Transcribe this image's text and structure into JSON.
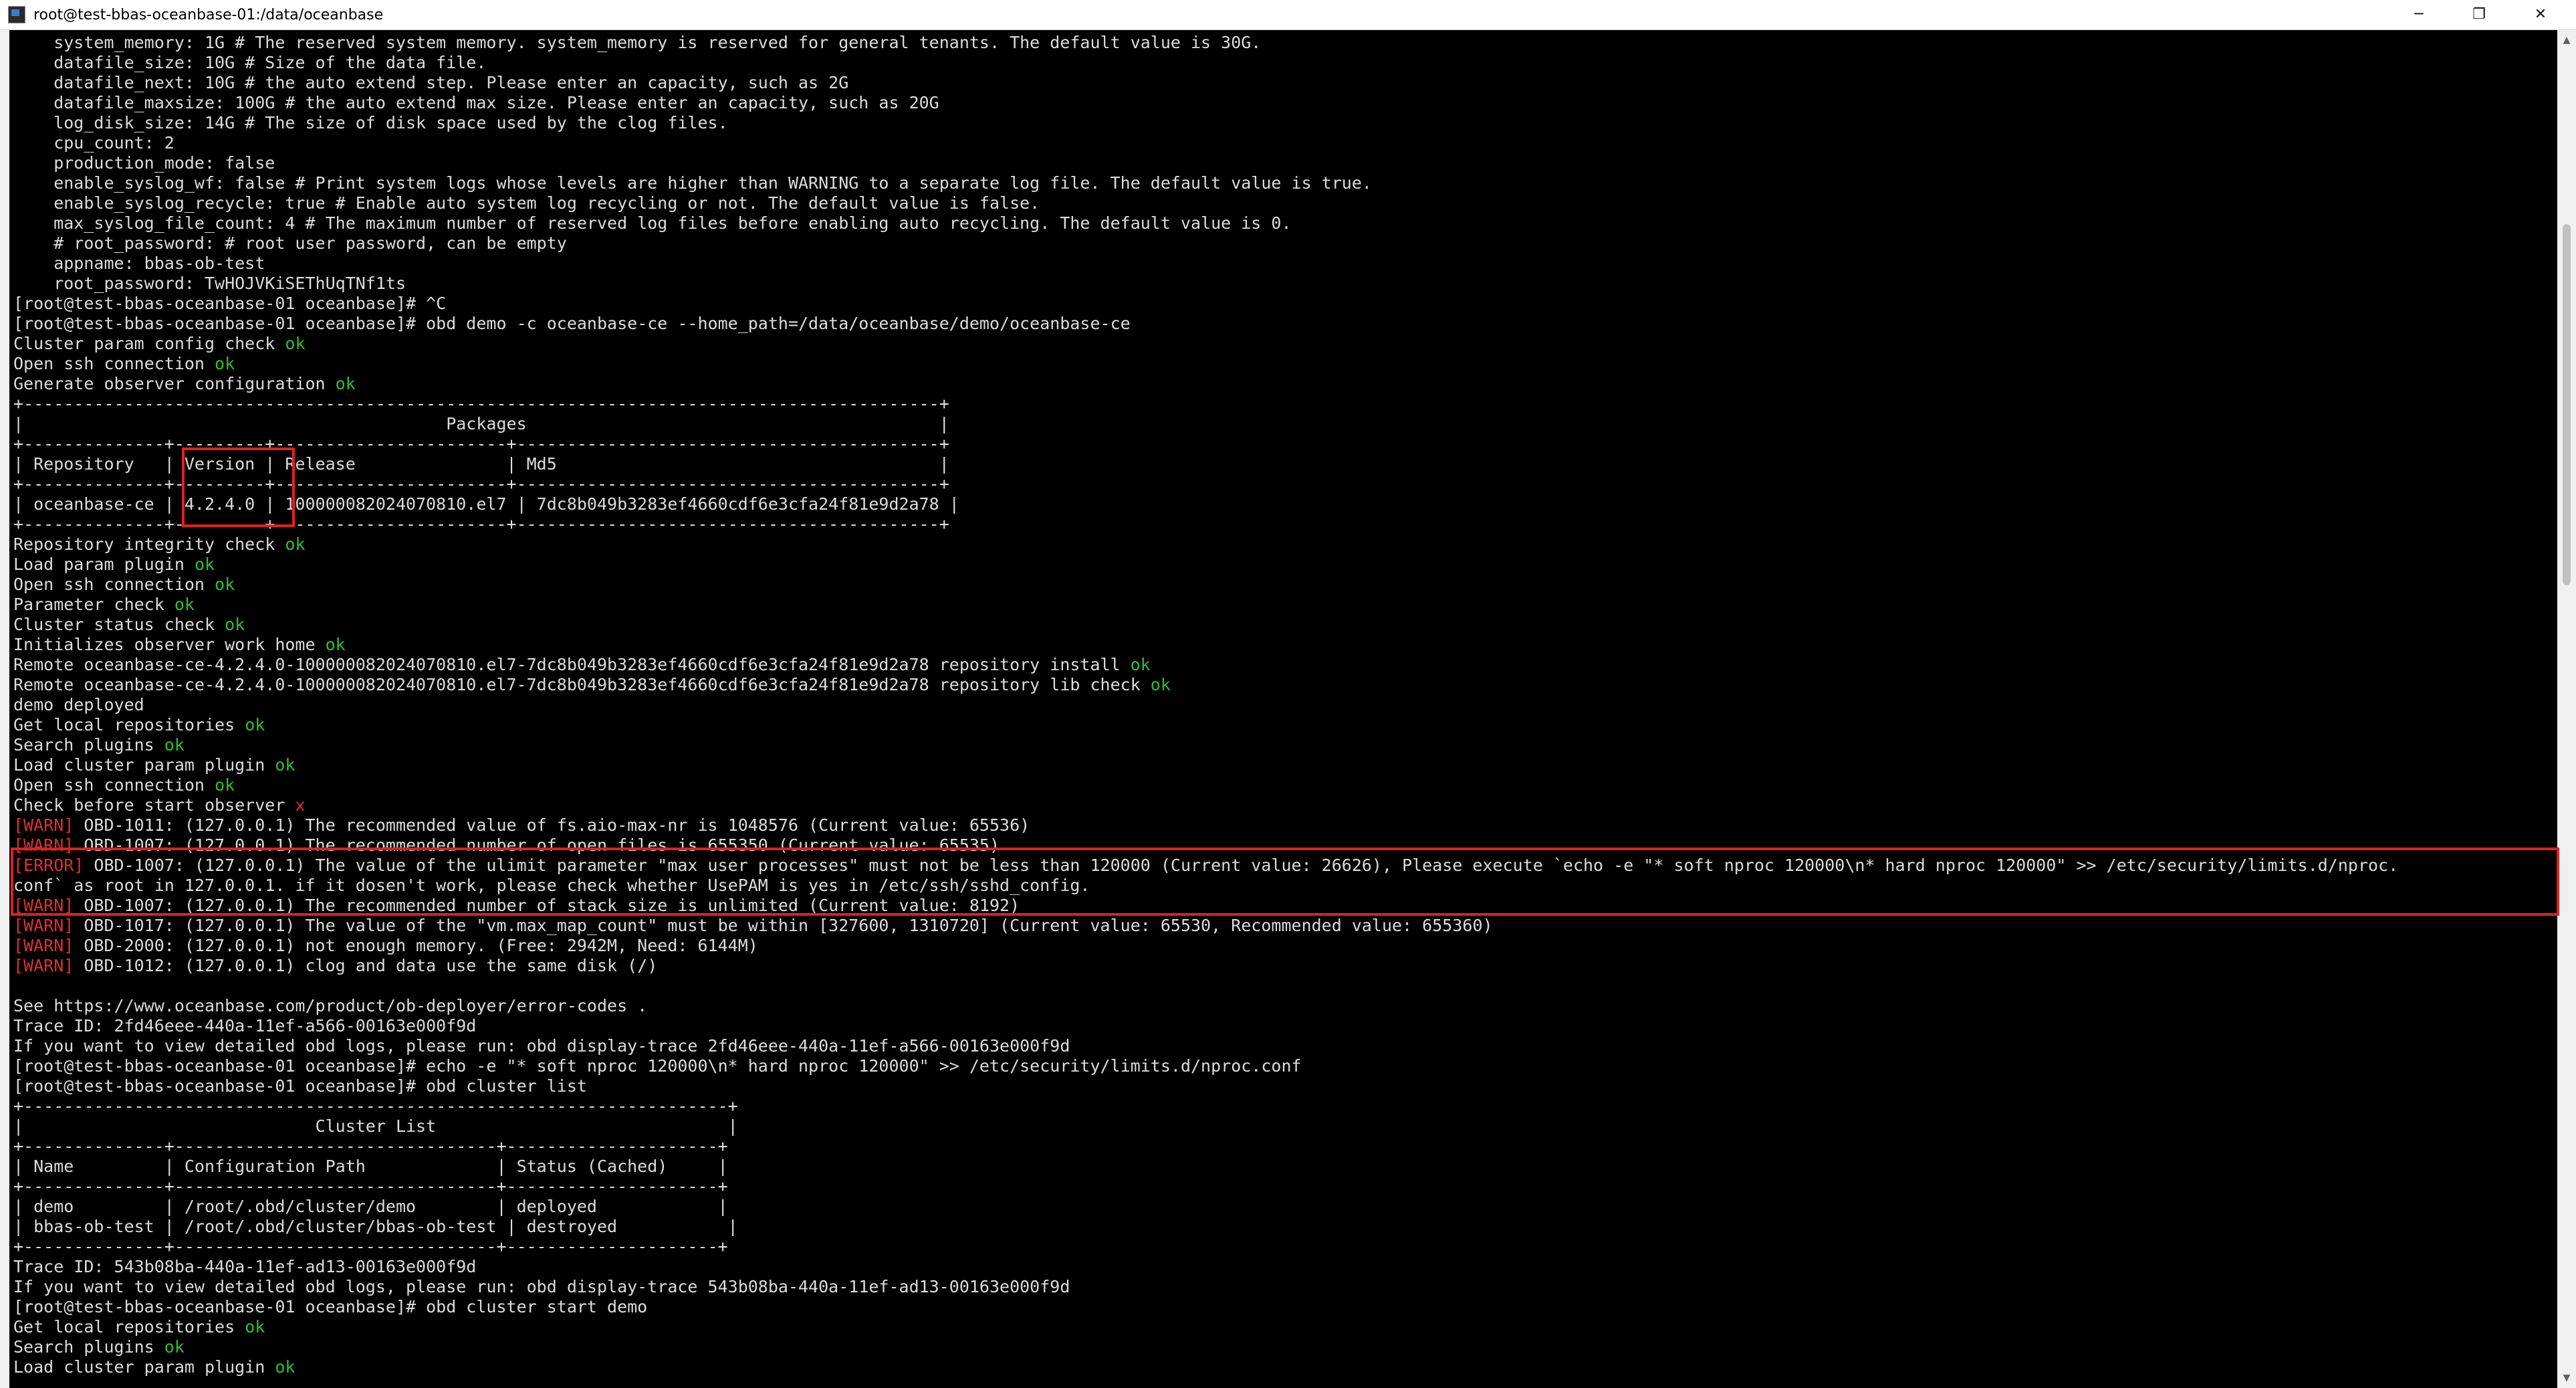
{
  "window": {
    "title": "root@test-bbas-oceanbase-01:/data/oceanbase",
    "minimize_icon": "─",
    "maximize_icon": "❐",
    "close_icon": "✕"
  },
  "scrollbar": {
    "up_arrow": "▲",
    "down_arrow": "▼"
  },
  "colors": {
    "ok": "#2fbf2f",
    "error": "#e03030",
    "highlight_box": "#e02020",
    "text": "#dcdcdc",
    "background": "#000000"
  },
  "terminal": {
    "lines": [
      [
        {
          "t": "    system_memory: 1G # The reserved system memory. system_memory is reserved for general tenants. The default value is 30G."
        }
      ],
      [
        {
          "t": "    datafile_size: 10G # Size of the data file."
        }
      ],
      [
        {
          "t": "    datafile_next: 10G # the auto extend step. Please enter an capacity, such as 2G"
        }
      ],
      [
        {
          "t": "    datafile_maxsize: 100G # the auto extend max size. Please enter an capacity, such as 20G"
        }
      ],
      [
        {
          "t": "    log_disk_size: 14G # The size of disk space used by the clog files."
        }
      ],
      [
        {
          "t": "    cpu_count: 2"
        }
      ],
      [
        {
          "t": "    production_mode: false"
        }
      ],
      [
        {
          "t": "    enable_syslog_wf: false # Print system logs whose levels are higher than WARNING to a separate log file. The default value is true."
        }
      ],
      [
        {
          "t": "    enable_syslog_recycle: true # Enable auto system log recycling or not. The default value is false."
        }
      ],
      [
        {
          "t": "    max_syslog_file_count: 4 # The maximum number of reserved log files before enabling auto recycling. The default value is 0."
        }
      ],
      [
        {
          "t": "    # root_password: # root user password, can be empty"
        }
      ],
      [
        {
          "t": "    appname: bbas-ob-test"
        }
      ],
      [
        {
          "t": "    root_password: TwHOJVKiSEThUqTNf1ts"
        }
      ],
      [
        {
          "t": "[root@test-bbas-oceanbase-01 oceanbase]# ^C"
        }
      ],
      [
        {
          "t": "[root@test-bbas-oceanbase-01 oceanbase]# obd demo -c oceanbase-ce --home_path=/data/oceanbase/demo/oceanbase-ce"
        }
      ],
      [
        {
          "t": "Cluster param config check "
        },
        {
          "t": "ok",
          "c": "ok"
        }
      ],
      [
        {
          "t": "Open ssh connection "
        },
        {
          "t": "ok",
          "c": "ok"
        }
      ],
      [
        {
          "t": "Generate observer configuration "
        },
        {
          "t": "ok",
          "c": "ok"
        }
      ],
      [
        {
          "t": "+-------------------------------------------------------------------------------------------+"
        }
      ],
      [
        {
          "t": "|                                          Packages                                         |"
        }
      ],
      [
        {
          "t": "+--------------+---------+-----------------------+------------------------------------------+"
        }
      ],
      [
        {
          "t": "| Repository   | Version | Release               | Md5                                      |"
        }
      ],
      [
        {
          "t": "+--------------+---------+-----------------------+------------------------------------------+"
        }
      ],
      [
        {
          "t": "| oceanbase-ce | 4.2.4.0 | 100000082024070810.el7 | 7dc8b049b3283ef4660cdf6e3cfa24f81e9d2a78 |"
        }
      ],
      [
        {
          "t": "+--------------+---------+-----------------------+------------------------------------------+"
        }
      ],
      [
        {
          "t": "Repository integrity check "
        },
        {
          "t": "ok",
          "c": "ok"
        }
      ],
      [
        {
          "t": "Load param plugin "
        },
        {
          "t": "ok",
          "c": "ok"
        }
      ],
      [
        {
          "t": "Open ssh connection "
        },
        {
          "t": "ok",
          "c": "ok"
        }
      ],
      [
        {
          "t": "Parameter check "
        },
        {
          "t": "ok",
          "c": "ok"
        }
      ],
      [
        {
          "t": "Cluster status check "
        },
        {
          "t": "ok",
          "c": "ok"
        }
      ],
      [
        {
          "t": "Initializes observer work home "
        },
        {
          "t": "ok",
          "c": "ok"
        }
      ],
      [
        {
          "t": "Remote oceanbase-ce-4.2.4.0-100000082024070810.el7-7dc8b049b3283ef4660cdf6e3cfa24f81e9d2a78 repository install "
        },
        {
          "t": "ok",
          "c": "ok"
        }
      ],
      [
        {
          "t": "Remote oceanbase-ce-4.2.4.0-100000082024070810.el7-7dc8b049b3283ef4660cdf6e3cfa24f81e9d2a78 repository lib check "
        },
        {
          "t": "ok",
          "c": "ok"
        }
      ],
      [
        {
          "t": "demo deployed"
        }
      ],
      [
        {
          "t": "Get local repositories "
        },
        {
          "t": "ok",
          "c": "ok"
        }
      ],
      [
        {
          "t": "Search plugins "
        },
        {
          "t": "ok",
          "c": "ok"
        }
      ],
      [
        {
          "t": "Load cluster param plugin "
        },
        {
          "t": "ok",
          "c": "ok"
        }
      ],
      [
        {
          "t": "Open ssh connection "
        },
        {
          "t": "ok",
          "c": "ok"
        }
      ],
      [
        {
          "t": "Check before start observer "
        },
        {
          "t": "x",
          "c": "red"
        }
      ],
      [
        {
          "t": "[WARN]",
          "c": "red"
        },
        {
          "t": " OBD-1011: (127.0.0.1) The recommended value of fs.aio-max-nr is 1048576 (Current value: 65536)"
        }
      ],
      [
        {
          "t": "[WARN]",
          "c": "red"
        },
        {
          "t": " OBD-1007: (127.0.0.1) The recommended number of open files is 655350 (Current value: 65535)"
        }
      ],
      [
        {
          "t": "[ERROR]",
          "c": "red"
        },
        {
          "t": " OBD-1007: (127.0.0.1) The value of the ulimit parameter \"max user processes\" must not be less than 120000 (Current value: 26626), Please execute `echo -e \"* soft nproc 120000\\n* hard nproc 120000\" >> /etc/security/limits.d/nproc."
        }
      ],
      [
        {
          "t": "conf` as root in 127.0.0.1. if it dosen't work, please check whether UsePAM is yes in /etc/ssh/sshd_config."
        }
      ],
      [
        {
          "t": "[WARN]",
          "c": "red"
        },
        {
          "t": " OBD-1007: (127.0.0.1) The recommended number of stack size is unlimited (Current value: 8192)"
        }
      ],
      [
        {
          "t": "[WARN]",
          "c": "red"
        },
        {
          "t": " OBD-1017: (127.0.0.1) The value of the \"vm.max_map_count\" must be within [327600, 1310720] (Current value: 65530, Recommended value: 655360)"
        }
      ],
      [
        {
          "t": "[WARN]",
          "c": "red"
        },
        {
          "t": " OBD-2000: (127.0.0.1) not enough memory. (Free: 2942M, Need: 6144M)"
        }
      ],
      [
        {
          "t": "[WARN]",
          "c": "red"
        },
        {
          "t": " OBD-1012: (127.0.0.1) clog and data use the same disk (/)"
        }
      ],
      [
        {
          "t": ""
        }
      ],
      [
        {
          "t": "See https://www.oceanbase.com/product/ob-deployer/error-codes ."
        }
      ],
      [
        {
          "t": "Trace ID: 2fd46eee-440a-11ef-a566-00163e000f9d"
        }
      ],
      [
        {
          "t": "If you want to view detailed obd logs, please run: obd display-trace 2fd46eee-440a-11ef-a566-00163e000f9d"
        }
      ],
      [
        {
          "t": "[root@test-bbas-oceanbase-01 oceanbase]# echo -e \"* soft nproc 120000\\n* hard nproc 120000\" >> /etc/security/limits.d/nproc.conf"
        }
      ],
      [
        {
          "t": "[root@test-bbas-oceanbase-01 oceanbase]# obd cluster list"
        }
      ],
      [
        {
          "t": "+----------------------------------------------------------------------+"
        }
      ],
      [
        {
          "t": "|                             Cluster List                             |"
        }
      ],
      [
        {
          "t": "+--------------+--------------------------------+---------------------+"
        }
      ],
      [
        {
          "t": "| Name         | Configuration Path             | Status (Cached)     |"
        }
      ],
      [
        {
          "t": "+--------------+--------------------------------+---------------------+"
        }
      ],
      [
        {
          "t": "| demo         | /root/.obd/cluster/demo        | deployed            |"
        }
      ],
      [
        {
          "t": "| bbas-ob-test | /root/.obd/cluster/bbas-ob-test | destroyed           |"
        }
      ],
      [
        {
          "t": "+--------------+--------------------------------+---------------------+"
        }
      ],
      [
        {
          "t": "Trace ID: 543b08ba-440a-11ef-ad13-00163e000f9d"
        }
      ],
      [
        {
          "t": "If you want to view detailed obd logs, please run: obd display-trace 543b08ba-440a-11ef-ad13-00163e000f9d"
        }
      ],
      [
        {
          "t": "[root@test-bbas-oceanbase-01 oceanbase]# obd cluster start demo"
        }
      ],
      [
        {
          "t": "Get local repositories "
        },
        {
          "t": "ok",
          "c": "ok"
        }
      ],
      [
        {
          "t": "Search plugins "
        },
        {
          "t": "ok",
          "c": "ok"
        }
      ],
      [
        {
          "t": "Load cluster param plugin "
        },
        {
          "t": "ok",
          "c": "ok"
        }
      ]
    ]
  }
}
